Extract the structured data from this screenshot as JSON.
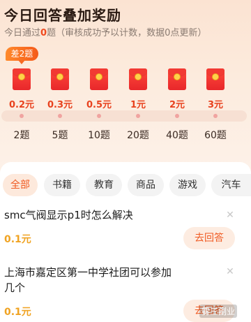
{
  "header": {
    "title": "今日回答叠加奖励",
    "subtitle_prefix": "今日通过",
    "subtitle_count": "0",
    "subtitle_suffix": "题（审核成功予以计数，数据0点更新）"
  },
  "badge": "差2题",
  "rewards": [
    {
      "amount": "0.2元",
      "count": "2题"
    },
    {
      "amount": "0.3元",
      "count": "5题"
    },
    {
      "amount": "0.5元",
      "count": "10题"
    },
    {
      "amount": "1元",
      "count": "20题"
    },
    {
      "amount": "2元",
      "count": "40题"
    },
    {
      "amount": "3元",
      "count": "60题"
    }
  ],
  "tabs": [
    "全部",
    "书籍",
    "教育",
    "商品",
    "游戏",
    "汽车"
  ],
  "questions": [
    {
      "title": "smc气阀显示p1时怎么解决",
      "reward": "0.1元",
      "button": "去回答"
    },
    {
      "title": "上海市嘉定区第一中学社团可以参加几个",
      "reward": "0.1元",
      "button": "去回答"
    }
  ],
  "watermark": "雾三副业",
  "colors": {
    "accent": "#f05a22",
    "reward": "#f0a322",
    "envelope": "#e8272a"
  }
}
